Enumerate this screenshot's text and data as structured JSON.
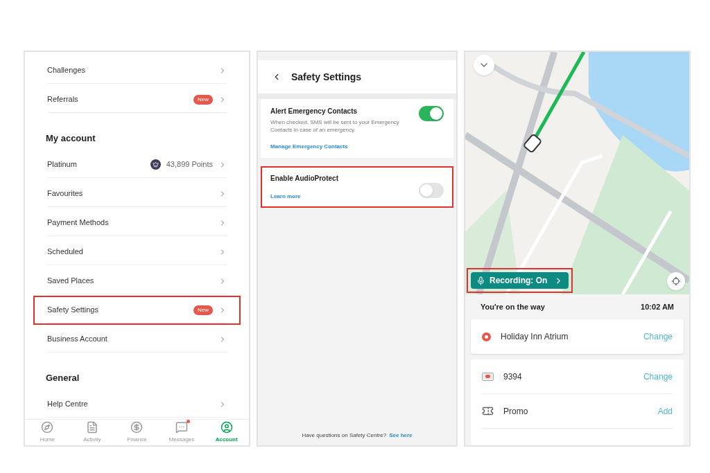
{
  "account": {
    "items": [
      {
        "kind": "item",
        "label": "Challenges",
        "highlighted": false
      },
      {
        "kind": "item",
        "label": "Referrals",
        "badge": "New",
        "highlighted": false
      },
      {
        "kind": "heading",
        "label": "My account"
      },
      {
        "kind": "item",
        "label": "Platinum",
        "points": "43,899 Points",
        "highlighted": false
      },
      {
        "kind": "item",
        "label": "Favourites",
        "highlighted": false
      },
      {
        "kind": "item",
        "label": "Payment Methods",
        "highlighted": false
      },
      {
        "kind": "item",
        "label": "Scheduled",
        "highlighted": false
      },
      {
        "kind": "item",
        "label": "Saved Places",
        "highlighted": false
      },
      {
        "kind": "item",
        "label": "Safety Settings",
        "badge": "New",
        "highlighted": true
      },
      {
        "kind": "item",
        "label": "Business Account",
        "highlighted": false
      },
      {
        "kind": "heading",
        "label": "General"
      },
      {
        "kind": "item",
        "label": "Help Centre",
        "highlighted": false
      }
    ],
    "nav": [
      {
        "label": "Home",
        "selected": false,
        "unread": false
      },
      {
        "label": "Activity",
        "selected": false,
        "unread": false
      },
      {
        "label": "Finance",
        "selected": false,
        "unread": false
      },
      {
        "label": "Messages",
        "selected": false,
        "unread": true
      },
      {
        "label": "Account",
        "selected": true,
        "unread": false
      }
    ]
  },
  "safety": {
    "title": "Safety Settings",
    "settings": [
      {
        "title": "Alert Emergency Contacts",
        "description": "When checked, SMS will be sent to your Emergency Contacts in case of an emergency.",
        "link": "Manage Emergency Contacts",
        "on": true,
        "highlighted": false
      },
      {
        "title": "Enable AudioProtect",
        "link": "Learn more",
        "on": false,
        "highlighted": true
      }
    ],
    "footer": {
      "text": "Have questions on Safety Centre?",
      "link": "See here"
    }
  },
  "trip": {
    "recording": {
      "label": "Recording: On",
      "highlighted": true
    },
    "status": "You're on the way",
    "time": "10:02 AM",
    "destination": {
      "name": "Holiday Inn Atrium",
      "action": "Change"
    },
    "payment": [
      {
        "kind": "card",
        "label": "9394",
        "action": "Change"
      },
      {
        "kind": "promo",
        "label": "Promo",
        "action": "Add"
      }
    ]
  }
}
